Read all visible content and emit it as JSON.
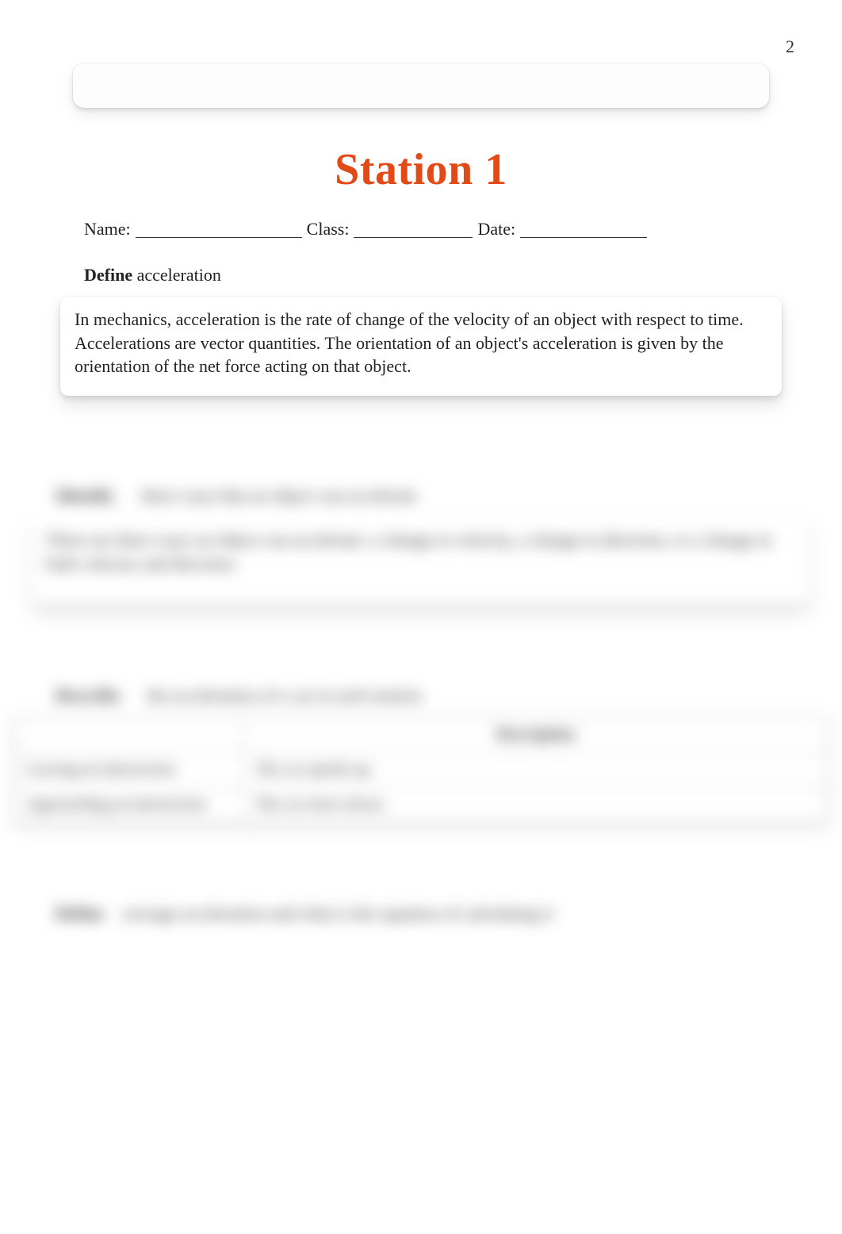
{
  "page_number": "2",
  "title": "Station 1",
  "info_row": {
    "name_label": "Name:",
    "class_label": "Class:",
    "date_label": "Date:"
  },
  "q1": {
    "prompt_bold": "Define",
    "prompt_rest": " acceleration",
    "answer": "In mechanics, acceleration is the rate of change of the velocity of an object with respect to time. Accelerations are vector quantities. The orientation of an object's acceleration is given by the orientation of the net force acting on that object."
  },
  "q2": {
    "prompt_bold": "Identify",
    "prompt_rest": " three ways that an object can accelerate",
    "answer": "There are three ways an object can accelerate: a change in velocity, a change in direction, or a change in both velocity and direction."
  },
  "q3": {
    "prompt_bold": "Describe",
    "prompt_rest": " the acceleration of a car in each motion",
    "table": {
      "header_blank": "",
      "header_desc": "Description",
      "rows": [
        {
          "label": "Leaving an intersection",
          "desc": "The car speeds up."
        },
        {
          "label": "Approaching an intersection",
          "desc": "The car slows down."
        }
      ]
    }
  },
  "q4": {
    "prompt_bold": "Define",
    "prompt_rest": " average acceleration and what is the equation of calculating it"
  }
}
